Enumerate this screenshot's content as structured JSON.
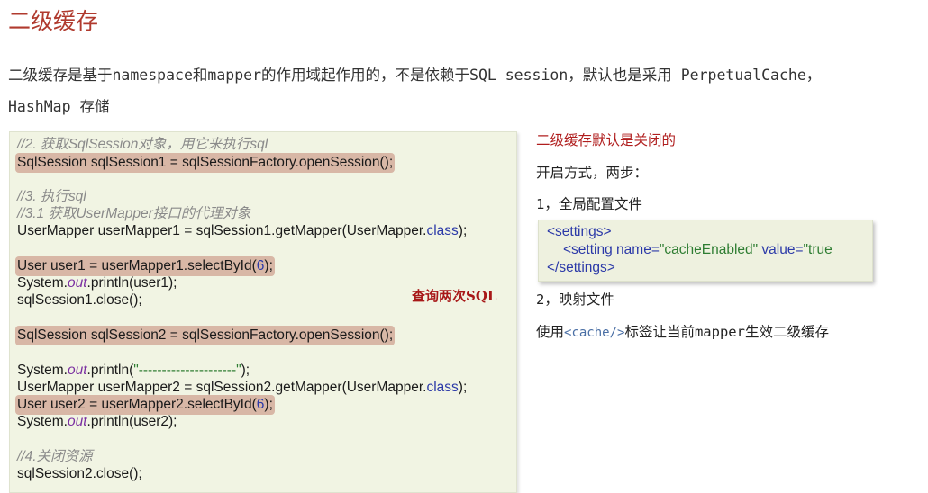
{
  "title": "二级缓存",
  "intro": {
    "line1": "二级缓存是基于namespace和mapper的作用域起作用的，不是依赖于SQL session，默认也是采用 PerpetualCache，",
    "line2": "HashMap 存储"
  },
  "code": {
    "c1": "//2. 获取SqlSession对象，用它来执行sql",
    "l1": "SqlSession sqlSession1 = sqlSessionFactory.openSession();",
    "c2": "//3. 执行sql",
    "c3": "//3.1 获取UserMapper接口的代理对象",
    "l2a": "UserMapper userMapper1 = sqlSession1.getMapper(UserMapper.",
    "kw_class": "class",
    "l2b": ");",
    "l3a": "User user1 = userMapper1.selectById(",
    "num6": "6",
    "l3b": ");",
    "sys": "System.",
    "out": "out",
    "println_user1": ".println(user1);",
    "close1": "sqlSession1.close();",
    "l5": "SqlSession sqlSession2 = sqlSessionFactory.openSession();",
    "println_open": ".println(",
    "dashes": "\"---------------------\"",
    "println_close": ");",
    "l6a": "UserMapper userMapper2 = sqlSession2.getMapper(UserMapper.",
    "l6b": ");",
    "l7a": "User user2 = userMapper2.selectById(",
    "l7b": ");",
    "println_user2": ".println(user2);",
    "c4": "//4.关闭资源",
    "close2": "sqlSession2.close();"
  },
  "annotation": "查询两次SQL",
  "right": {
    "default_off": "二级缓存默认是关闭的",
    "how_to": "开启方式，两步：",
    "step1": "1，全局配置文件",
    "step2": "2，映射文件",
    "use_prefix": "使用",
    "cache_tag": "<cache/>",
    "use_suffix": "标签让当前mapper生效二级缓存"
  },
  "snippet": {
    "settings_open": "<settings>",
    "setting_open": "<setting",
    "name_attr": " name=",
    "name_val": "\"cacheEnabled\"",
    "value_attr": " value=",
    "value_val": "\"true",
    "settings_close": "</settings>"
  },
  "colors": {
    "title": "#b03a2e",
    "highlight": "#d8b7a6",
    "code_bg": "#f1f4e3",
    "keyword": "#2b39a8",
    "string": "#2e7d32",
    "annotation": "#a81818"
  }
}
